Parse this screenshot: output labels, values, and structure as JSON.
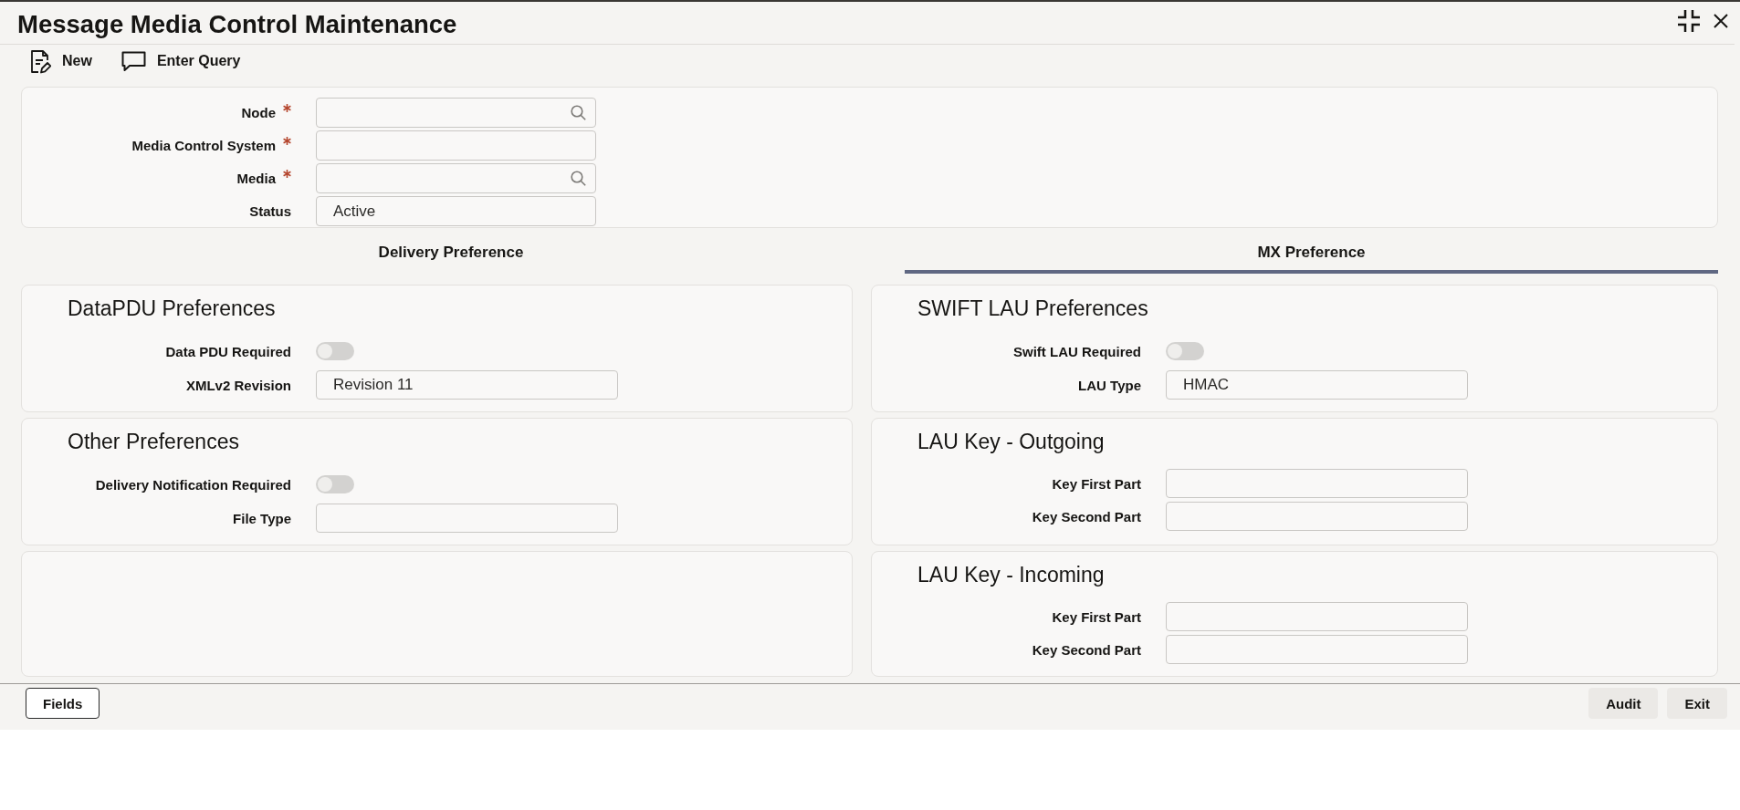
{
  "window": {
    "title": "Message Media Control Maintenance"
  },
  "toolbar": [
    {
      "kind": "new",
      "label": "New"
    },
    {
      "kind": "query",
      "label": "Enter Query"
    }
  ],
  "header_fields": [
    {
      "label": "Node",
      "required": true,
      "lookup": true
    },
    {
      "label": "Media Control System",
      "required": true,
      "lookup": false
    },
    {
      "label": "Media",
      "required": true,
      "lookup": true
    },
    {
      "label": "Status",
      "required": false,
      "lookup": false,
      "value": "Active"
    }
  ],
  "tabs": [
    {
      "label": "Delivery Preference",
      "selected": false
    },
    {
      "label": "MX Preference",
      "selected": true
    }
  ],
  "sections": {
    "left": [
      {
        "kind": "form",
        "title": "DataPDU Preferences",
        "fields": [
          {
            "kind": "toggle",
            "label": "Data PDU Required",
            "checked": false
          },
          {
            "kind": "text",
            "label": "XMLv2 Revision",
            "value": "Revision 11"
          }
        ]
      },
      {
        "kind": "form",
        "title": "Other Preferences",
        "fields": [
          {
            "kind": "toggle",
            "label": "Delivery Notification Required",
            "checked": false
          },
          {
            "kind": "text",
            "label": "File Type"
          }
        ]
      },
      {
        "kind": "blank"
      }
    ],
    "right": [
      {
        "kind": "form",
        "title": "SWIFT LAU Preferences",
        "fields": [
          {
            "kind": "toggle",
            "label": "Swift LAU Required",
            "checked": false
          },
          {
            "kind": "text",
            "label": "LAU Type",
            "value": "HMAC"
          }
        ]
      },
      {
        "kind": "form",
        "title": "LAU Key - Outgoing",
        "fields": [
          {
            "kind": "text",
            "label": "Key First Part"
          },
          {
            "kind": "text",
            "label": "Key Second Part"
          }
        ]
      },
      {
        "kind": "form",
        "title": "LAU Key - Incoming",
        "fields": [
          {
            "kind": "text",
            "label": "Key First Part"
          },
          {
            "kind": "text",
            "label": "Key Second Part"
          }
        ]
      }
    ]
  },
  "footer": {
    "left_buttons": [
      {
        "kind": "outlined",
        "label": "Fields"
      }
    ],
    "right_buttons": [
      {
        "kind": "filled",
        "label": "Audit"
      },
      {
        "kind": "filled",
        "label": "Exit"
      }
    ]
  }
}
